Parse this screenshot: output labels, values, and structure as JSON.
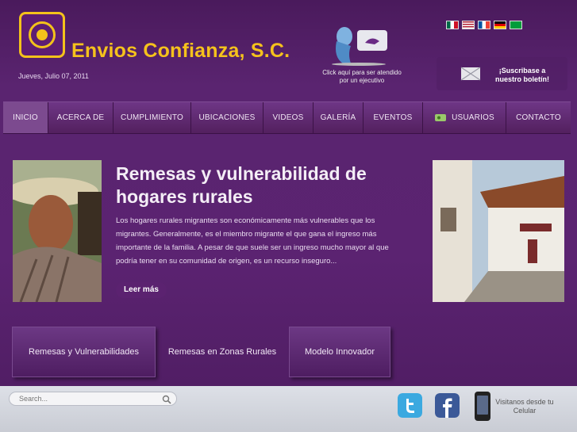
{
  "brand": {
    "name": "Envios Confianza, S.C.",
    "date": "Jueves, Julio 07, 2011"
  },
  "header": {
    "exec_text": "Click aquí para ser atendido por un ejecutivo",
    "newsletter": "¡Suscribase a nuestro boletín!",
    "flags": [
      "mexico-flag",
      "usa-flag",
      "france-flag",
      "germany-flag",
      "brazil-flag"
    ]
  },
  "nav": {
    "items": [
      "INICIO",
      "ACERCA DE",
      "CUMPLIMIENTO",
      "UBICACIONES",
      "VIDEOS",
      "GALERÍA",
      "EVENTOS",
      "USUARIOS",
      "CONTACTO"
    ]
  },
  "feature": {
    "headline": "Remesas y vulnerabilidad de hogares rurales",
    "summary": "Los hogares rurales migrantes son económicamente más vulnerables que los migrantes. Generalmente, es el miembro migrante el que gana el ingreso más importante de la familia. A pesar de que suele ser un ingreso mucho mayor al que podría tener en su comunidad de origen, es un recurso inseguro...",
    "read_more": "Leer más"
  },
  "tabs": [
    "Remesas y Vulnerabilidades",
    "Remesas en Zonas Rurales",
    "Modelo Innovador"
  ],
  "footer": {
    "search_placeholder": "Search...",
    "celular": "Visitanos desde tu Celular"
  },
  "colors": {
    "accent": "#f5c21c",
    "background": "#5b2371",
    "footer": "#d3d6de"
  }
}
